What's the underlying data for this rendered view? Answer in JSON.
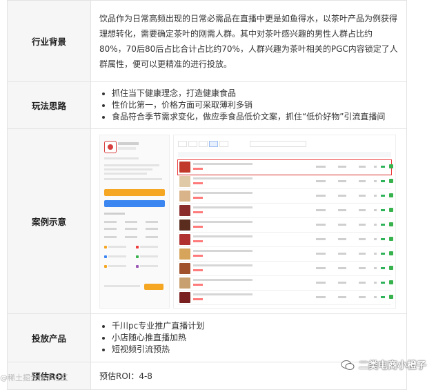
{
  "rows": {
    "background": {
      "label": "行业背景",
      "text": "饮品作为日常高频出现的日常必需品在直播中更是如鱼得水，以茶叶产品为例获得理想转化，需要确定茶叶的刚需人群。其中对茶叶感兴趣的男性人群占比约80%，70后80后占比合计占比约70%，人群兴趣为茶叶相关的PGC内容锁定了人群属性，便可以更精准的进行投放。"
    },
    "strategy": {
      "label": "玩法思路",
      "items": [
        "抓住当下健康理念，打造健康食品",
        "性价比第一，价格方面可采取薄利多销",
        "食品符合季节需求变化，做应季食品低价文案，抓住“低价好物”引流直播间"
      ]
    },
    "case": {
      "label": "案例示意",
      "thumb_colors": [
        "#c0392b",
        "#e0c9a6",
        "#d9b48a",
        "#8b2c2c",
        "#5a2d1f",
        "#b03030",
        "#d6a45a",
        "#a0522d",
        "#c8a070",
        "#7a1f1f",
        "#e8d0a0",
        "#4a1c14"
      ]
    },
    "delivery": {
      "label": "投放产品",
      "items": [
        "千川pc专业推广直播计划",
        "小店随心推直播加热",
        "短视频引流预热"
      ]
    },
    "roi": {
      "label": "预估ROI",
      "text": "预估ROI：4-8"
    }
  },
  "watermark": {
    "left": "@稀土掘金技术社区",
    "right": "二类电商小橙子"
  },
  "colors": {
    "label_bg": "#f6f6f6",
    "border": "#e3e3e3",
    "highlight": "#ef3b3b"
  }
}
